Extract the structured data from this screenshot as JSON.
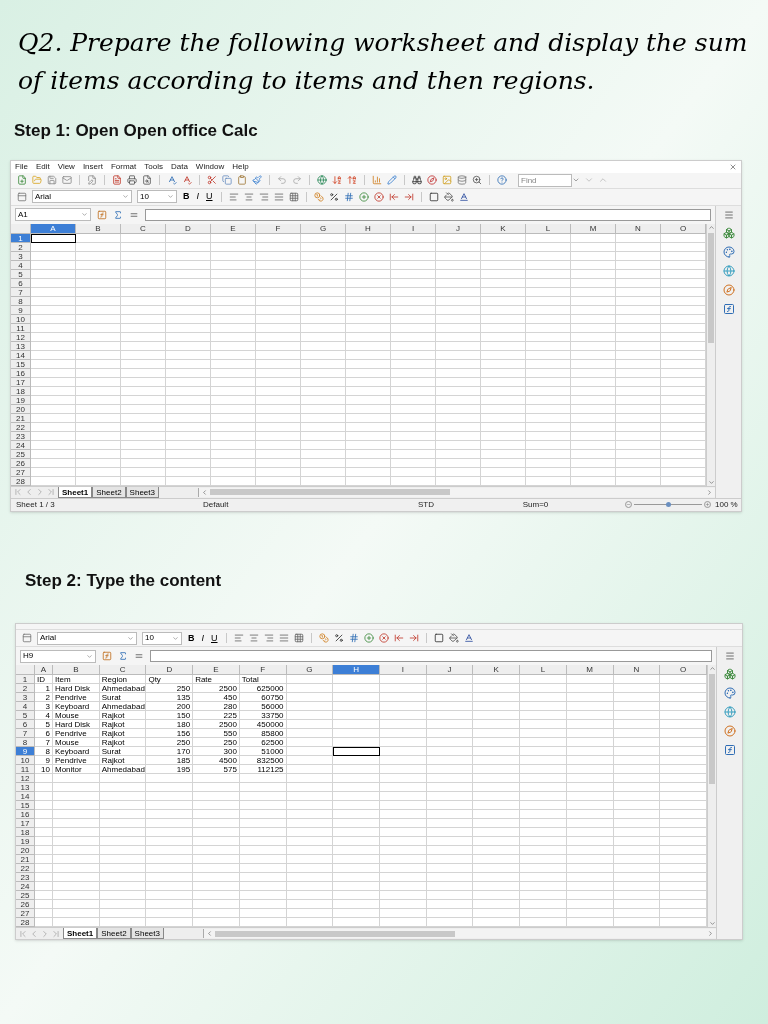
{
  "heading": "Q2. Prepare the following worksheet and display the sum of items according to items and then regions.",
  "steps": [
    {
      "label": "Step 1: Open Open office Calc",
      "window": {
        "menu": [
          "File",
          "Edit",
          "View",
          "Insert",
          "Format",
          "Tools",
          "Data",
          "Window",
          "Help"
        ],
        "find": {
          "placeholder": "Find"
        },
        "font": "Arial",
        "size": "10",
        "bold": "B",
        "italic": "I",
        "underline": "U",
        "name_box": "A1",
        "columns": [
          {
            "label": "A",
            "selected": true
          },
          {
            "label": "B",
            "selected": false
          },
          {
            "label": "C",
            "selected": false
          },
          {
            "label": "D",
            "selected": false
          },
          {
            "label": "E",
            "selected": false
          },
          {
            "label": "F",
            "selected": false
          },
          {
            "label": "G",
            "selected": false
          },
          {
            "label": "H",
            "selected": false
          },
          {
            "label": "I",
            "selected": false
          },
          {
            "label": "J",
            "selected": false
          },
          {
            "label": "K",
            "selected": false
          },
          {
            "label": "L",
            "selected": false
          },
          {
            "label": "M",
            "selected": false
          },
          {
            "label": "N",
            "selected": false
          },
          {
            "label": "O",
            "selected": false
          }
        ],
        "rows": [
          {
            "label": "1",
            "selected": true
          },
          {
            "label": "2",
            "selected": false
          },
          {
            "label": "3",
            "selected": false
          },
          {
            "label": "4",
            "selected": false
          },
          {
            "label": "5",
            "selected": false
          },
          {
            "label": "6",
            "selected": false
          },
          {
            "label": "7",
            "selected": false
          },
          {
            "label": "8",
            "selected": false
          },
          {
            "label": "9",
            "selected": false
          },
          {
            "label": "10",
            "selected": false
          },
          {
            "label": "11",
            "selected": false
          },
          {
            "label": "12",
            "selected": false
          },
          {
            "label": "13",
            "selected": false
          },
          {
            "label": "14",
            "selected": false
          },
          {
            "label": "15",
            "selected": false
          },
          {
            "label": "16",
            "selected": false
          },
          {
            "label": "17",
            "selected": false
          },
          {
            "label": "18",
            "selected": false
          },
          {
            "label": "19",
            "selected": false
          },
          {
            "label": "20",
            "selected": false
          },
          {
            "label": "21",
            "selected": false
          },
          {
            "label": "22",
            "selected": false
          },
          {
            "label": "23",
            "selected": false
          },
          {
            "label": "24",
            "selected": false
          },
          {
            "label": "25",
            "selected": false
          },
          {
            "label": "26",
            "selected": false
          },
          {
            "label": "27",
            "selected": false
          },
          {
            "label": "28",
            "selected": false
          }
        ],
        "sheets": [
          {
            "label": "Sheet1",
            "selected": true
          },
          {
            "label": "Sheet2",
            "selected": false
          },
          {
            "label": "Sheet3",
            "selected": false
          }
        ],
        "status_bar": {
          "sheet": "Sheet 1 / 3",
          "style": "Default",
          "mode": "STD",
          "sum": "Sum=0",
          "zoom_slider": {
            "level": 0.5
          },
          "zoom": "100 %"
        }
      }
    },
    {
      "label": "Step 2: Type the content",
      "window": {
        "font": "Arial",
        "size": "10",
        "bold": "B",
        "italic": "I",
        "underline": "U",
        "name_box": "H9",
        "columns": [
          {
            "label": "A",
            "selected": false
          },
          {
            "label": "B",
            "selected": false
          },
          {
            "label": "C",
            "selected": false
          },
          {
            "label": "D",
            "selected": false
          },
          {
            "label": "E",
            "selected": false
          },
          {
            "label": "F",
            "selected": false
          },
          {
            "label": "G",
            "selected": false
          },
          {
            "label": "H",
            "selected": true
          },
          {
            "label": "I",
            "selected": false
          },
          {
            "label": "J",
            "selected": false
          },
          {
            "label": "K",
            "selected": false
          },
          {
            "label": "L",
            "selected": false
          },
          {
            "label": "M",
            "selected": false
          },
          {
            "label": "N",
            "selected": false
          },
          {
            "label": "O",
            "selected": false
          }
        ],
        "rows": [
          {
            "label": "1",
            "selected": false
          },
          {
            "label": "2",
            "selected": false
          },
          {
            "label": "3",
            "selected": false
          },
          {
            "label": "4",
            "selected": false
          },
          {
            "label": "5",
            "selected": false
          },
          {
            "label": "6",
            "selected": false
          },
          {
            "label": "7",
            "selected": false
          },
          {
            "label": "8",
            "selected": false
          },
          {
            "label": "9",
            "selected": true
          },
          {
            "label": "10",
            "selected": false
          },
          {
            "label": "11",
            "selected": false
          },
          {
            "label": "12",
            "selected": false
          },
          {
            "label": "13",
            "selected": false
          },
          {
            "label": "14",
            "selected": false
          },
          {
            "label": "15",
            "selected": false
          },
          {
            "label": "16",
            "selected": false
          },
          {
            "label": "17",
            "selected": false
          },
          {
            "label": "18",
            "selected": false
          },
          {
            "label": "19",
            "selected": false
          },
          {
            "label": "20",
            "selected": false
          },
          {
            "label": "21",
            "selected": false
          },
          {
            "label": "22",
            "selected": false
          },
          {
            "label": "23",
            "selected": false
          },
          {
            "label": "24",
            "selected": false
          },
          {
            "label": "25",
            "selected": false
          },
          {
            "label": "26",
            "selected": false
          },
          {
            "label": "27",
            "selected": false
          },
          {
            "label": "28",
            "selected": false
          }
        ],
        "cells": [
          [
            "ID",
            "Item",
            "Region",
            "Qty",
            "Rate",
            "Total"
          ],
          [
            "1",
            "Hard Disk",
            "Ahmedabad",
            "250",
            "2500",
            "625000"
          ],
          [
            "2",
            "Pendrive",
            "Surat",
            "135",
            "450",
            "60750"
          ],
          [
            "3",
            "Keyboard",
            "Ahmedabad",
            "200",
            "280",
            "56000"
          ],
          [
            "4",
            "Mouse",
            "Rajkot",
            "150",
            "225",
            "33750"
          ],
          [
            "5",
            "Hard Disk",
            "Rajkot",
            "180",
            "2500",
            "450000"
          ],
          [
            "6",
            "Pendrive",
            "Rajkot",
            "156",
            "550",
            "85800"
          ],
          [
            "7",
            "Mouse",
            "Rajkot",
            "250",
            "250",
            "62500"
          ],
          [
            "8",
            "Keyboard",
            "Surat",
            "170",
            "300",
            "51000"
          ],
          [
            "9",
            "Pendrive",
            "Rajkot",
            "185",
            "4500",
            "832500"
          ],
          [
            "10",
            "Monitor",
            "Ahmedabad",
            "195",
            "575",
            "112125"
          ]
        ],
        "sheets": [
          {
            "label": "Sheet1",
            "selected": true
          },
          {
            "label": "Sheet2",
            "selected": false
          },
          {
            "label": "Sheet3",
            "selected": false
          }
        ]
      }
    }
  ]
}
